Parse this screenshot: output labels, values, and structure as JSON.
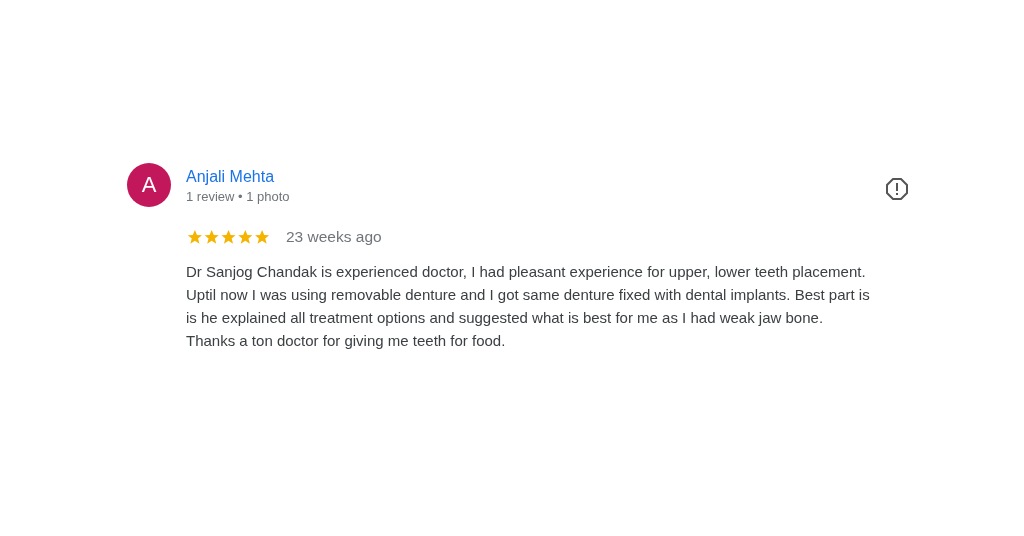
{
  "review": {
    "avatar_letter": "A",
    "author": "Anjali Mehta",
    "meta": "1 review • 1 photo",
    "stars": 5,
    "time": "23 weeks ago",
    "text": "Dr Sanjog Chandak is experienced doctor, I had pleasant experience for upper, lower teeth placement. Uptil now I was using removable denture and I got same denture fixed with dental implants. Best part is is he explained all treatment options and suggested what is best for me as I had weak jaw bone. Thanks a ton doctor for giving me teeth for food."
  }
}
